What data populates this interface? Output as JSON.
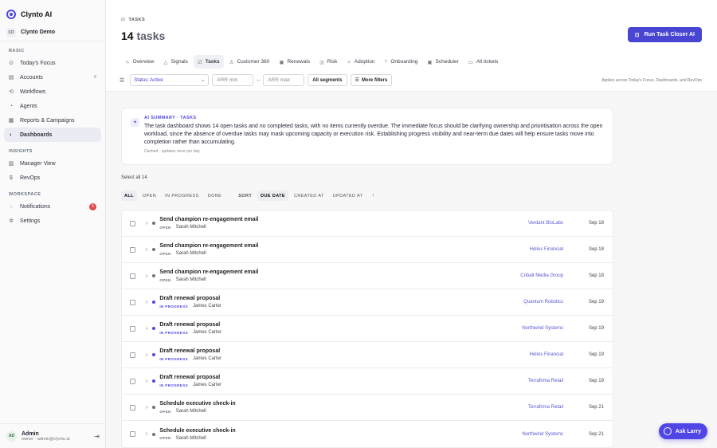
{
  "brand": {
    "name": "Clynto AI"
  },
  "org": {
    "badge": "CD",
    "name": "Clynto Demo"
  },
  "sidebar": {
    "basic_label": "BASIC",
    "basic": [
      {
        "label": "Today's Focus",
        "icon": "target-icon",
        "glyph": "⊙"
      },
      {
        "label": "Accounts",
        "icon": "building-icon",
        "glyph": "▤",
        "count": "6"
      },
      {
        "label": "Workflows",
        "icon": "workflow-icon",
        "glyph": "⟲"
      },
      {
        "label": "Agents",
        "icon": "user-icon",
        "glyph": "◔"
      },
      {
        "label": "Reports & Campaigns",
        "icon": "grid-icon",
        "glyph": "▦"
      },
      {
        "label": "Dashboards",
        "icon": "dashboard-icon",
        "glyph": "◐",
        "active": true
      }
    ],
    "insights_label": "INSIGHTS",
    "insights": [
      {
        "label": "Manager View",
        "icon": "bar-chart-icon",
        "glyph": "▥"
      },
      {
        "label": "RevOps",
        "icon": "dollar-icon",
        "glyph": "$"
      }
    ],
    "workspace_label": "WORKSPACE",
    "workspace": [
      {
        "label": "Notifications",
        "icon": "bell-icon",
        "glyph": "◌",
        "badge": "5"
      },
      {
        "label": "Settings",
        "icon": "gear-icon",
        "glyph": "✲"
      }
    ]
  },
  "user": {
    "initials": "AD",
    "name": "Admin",
    "sub": "owner · admin@clynto.ai"
  },
  "header": {
    "eyebrow": "TASKS",
    "count": "14",
    "title_suffix": "tasks",
    "run_button": "Run Task Closer AI"
  },
  "tabs": [
    {
      "label": "Overview",
      "icon": "activity-icon",
      "glyph": "∿"
    },
    {
      "label": "Signals",
      "icon": "alert-icon",
      "glyph": "△"
    },
    {
      "label": "Tasks",
      "icon": "checkbox-icon",
      "glyph": "☑",
      "active": true
    },
    {
      "label": "Customer 360",
      "icon": "person-icon",
      "glyph": "♙"
    },
    {
      "label": "Renewals",
      "icon": "calendar-icon",
      "glyph": "▣"
    },
    {
      "label": "Risk",
      "icon": "risk-icon",
      "glyph": "◎"
    },
    {
      "label": "Adoption",
      "icon": "sparkle-icon",
      "glyph": "✧"
    },
    {
      "label": "Onboarding",
      "icon": "branch-icon",
      "glyph": "⑂"
    },
    {
      "label": "Scheduler",
      "icon": "calendar-icon",
      "glyph": "▣"
    },
    {
      "label": "All tickets",
      "icon": "ticket-icon",
      "glyph": "▭"
    }
  ],
  "filters": {
    "status": "Status: Active",
    "arr_min": "ARR min",
    "arr_max": "ARR max",
    "segments": "All segments",
    "more": "More filters",
    "applies": "Applies across Today's Focus, Dashboards, and RevOps"
  },
  "summary": {
    "label": "AI SUMMARY · TASKS",
    "text": "The task dashboard shows 14 open tasks and no completed tasks, with no items currently overdue. The immediate focus should be clarifying ownership and prioritisation across the open workload, since the absence of overdue tasks may mask upcoming capacity or execution risk. Establishing progress visibility and near-term due dates will help ensure tasks move into completion rather than accumulating.",
    "footer": "Cached · updates once per day"
  },
  "select_all": "Select all 14",
  "status_tabs": [
    "ALL",
    "OPEN",
    "IN PROGRESS",
    "DONE"
  ],
  "sort": {
    "label": "SORT",
    "options": [
      "DUE DATE",
      "CREATED AT",
      "UPDATED AT"
    ],
    "selected": 0,
    "direction": "↑"
  },
  "colors": {
    "accent": "#4f46e5",
    "open": "#6b7280",
    "in_progress": "#4f46e5"
  },
  "tasks": [
    {
      "title": "Send champion re-engagement email",
      "status": "OPEN",
      "owner": "Sarah Mitchell",
      "account": "Verdant BioLabs",
      "date": "Sep 18"
    },
    {
      "title": "Send champion re-engagement email",
      "status": "OPEN",
      "owner": "Sarah Mitchell",
      "account": "Helios Financial",
      "date": "Sep 18"
    },
    {
      "title": "Send champion re-engagement email",
      "status": "OPEN",
      "owner": "Sarah Mitchell",
      "account": "Cobalt Media Group",
      "date": "Sep 18"
    },
    {
      "title": "Draft renewal proposal",
      "status": "IN PROGRESS",
      "owner": "James Carter",
      "account": "Quantum Robotics",
      "date": "Sep 19"
    },
    {
      "title": "Draft renewal proposal",
      "status": "IN PROGRESS",
      "owner": "James Carter",
      "account": "Northwind Systems",
      "date": "Sep 19"
    },
    {
      "title": "Draft renewal proposal",
      "status": "IN PROGRESS",
      "owner": "James Carter",
      "account": "Helios Financial",
      "date": "Sep 19"
    },
    {
      "title": "Draft renewal proposal",
      "status": "IN PROGRESS",
      "owner": "James Carter",
      "account": "Terrafirma Retail",
      "date": "Sep 19"
    },
    {
      "title": "Schedule executive check-in",
      "status": "OPEN",
      "owner": "Sarah Mitchell",
      "account": "Terrafirma Retail",
      "date": "Sep 21"
    },
    {
      "title": "Schedule executive check-in",
      "status": "OPEN",
      "owner": "Sarah Mitchell",
      "account": "Northwind Systems",
      "date": "Sep 21"
    }
  ],
  "ask": {
    "label": "Ask Larry"
  }
}
